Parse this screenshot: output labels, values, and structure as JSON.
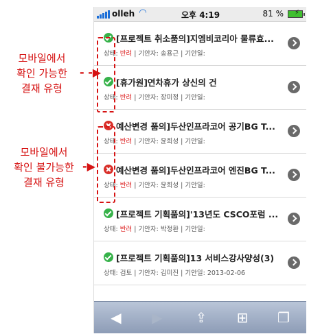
{
  "status_bar": {
    "carrier": "olleh",
    "time": "오후 4:19",
    "battery_percent": "81 %",
    "battery_level": 0.81,
    "icons": [
      "signal-icon",
      "wifi-icon",
      "battery-icon"
    ]
  },
  "meta_labels": {
    "status_prefix": "상태: ",
    "drafter_prefix": "기안자: ",
    "date_prefix": "기안일:"
  },
  "approvals": [
    {
      "icon": "approve-icon",
      "title": "[프로젝트 취소품의]지엠비코리아 물류효...",
      "status": "반려",
      "drafter": "송용근",
      "date": ""
    },
    {
      "icon": "approve-icon",
      "title": "[휴가원]연차휴가 상신의 건",
      "status": "반려",
      "drafter": "장미정",
      "date": ""
    },
    {
      "icon": "blocked-icon",
      "title": "예산변경 품의]두산인프라코어 공기BG T...",
      "status": "반려",
      "drafter": "윤희성",
      "date": ""
    },
    {
      "icon": "blocked-icon",
      "title": "예산변경 품의]두산인프라코어 엔진BG T...",
      "status": "반려",
      "drafter": "윤희성",
      "date": ""
    },
    {
      "icon": "approve-icon",
      "title": "[프로젝트 기획품의]'13년도 CSCO포럼 ...",
      "status": "반려",
      "drafter": "박정환",
      "date": ""
    },
    {
      "icon": "approve-icon",
      "title": "[프로젝트 기획품의]13 서비스강사양성(3)",
      "status": "검토",
      "drafter": "김미진",
      "date": "2013-02-06"
    }
  ],
  "annotations": [
    {
      "lines": [
        "모바일에서",
        "확인 가능한",
        "결재 유형"
      ]
    },
    {
      "lines": [
        "모바일에서",
        "확인 불가능한",
        "결재 유형"
      ]
    }
  ],
  "colors": {
    "annotation": "#d61212",
    "rejected_status": "#dd2222",
    "approve_icon": "#37b24a",
    "blocked_icon": "#d9302a",
    "toolbar": "#8d9cb6"
  },
  "toolbar": {
    "buttons": [
      "back-icon",
      "forward-icon",
      "share-icon",
      "bookmarks-icon",
      "tabs-icon"
    ]
  }
}
